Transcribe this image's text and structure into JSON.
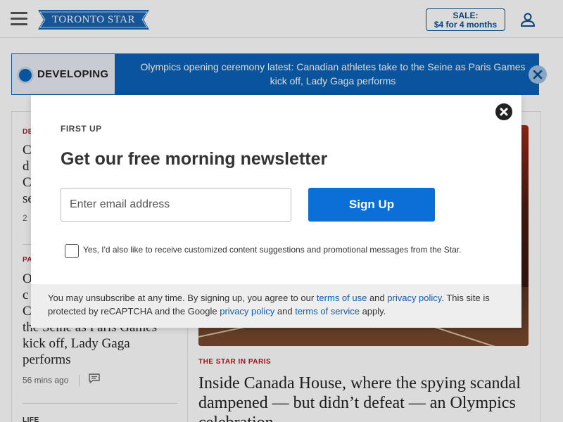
{
  "header": {
    "logo_text": "TORONTO STAR",
    "sale_line1": "SALE:",
    "sale_line2": "$4 for 4 months"
  },
  "banner": {
    "tag": "DEVELOPING",
    "headline": "Olympics opening ceremony latest: Canadian athletes take to the Seine as Paris Games kick off, Lady Gaga performs"
  },
  "left_column": {
    "story1": {
      "kicker": "DE",
      "headline_lines": [
        "C",
        "d",
        "C",
        "se"
      ],
      "meta": "2"
    },
    "story2": {
      "kicker": "PA",
      "headline_lines": [
        "O",
        "c",
        "C",
        "the Seine as Paris Games",
        "kick off, Lady Gaga",
        "performs"
      ],
      "meta": "56 mins ago"
    },
    "story3": {
      "kicker": "LIFE"
    }
  },
  "main_story": {
    "kicker": "THE STAR IN PARIS",
    "headline": "Inside Canada House, where the spying scandal dampened — but didn’t defeat — an Olympics celebration"
  },
  "modal": {
    "eyebrow": "FIRST UP",
    "title": "Get our free morning newsletter",
    "email_placeholder": "Enter email address",
    "signup_label": "Sign Up",
    "consent": "Yes, I'd also like to receive customized content suggestions and promotional messages from the Star.",
    "footer": {
      "text1": "You may unsubscribe at any time. By signing up, you agree to our ",
      "link1": "terms of use",
      "text2": " and ",
      "link2": "privacy policy",
      "text3": ". This site is protected by reCAPTCHA and the Google ",
      "link3": "privacy policy",
      "text4": " and ",
      "link4": "terms of service",
      "text5": " apply."
    }
  },
  "colors": {
    "brand_blue": "#0b62b6",
    "button_blue": "#0b6fd8",
    "kicker_red": "#c0111f"
  },
  "icons": [
    "hamburger-icon",
    "user-icon",
    "close-icon",
    "comment-icon"
  ]
}
